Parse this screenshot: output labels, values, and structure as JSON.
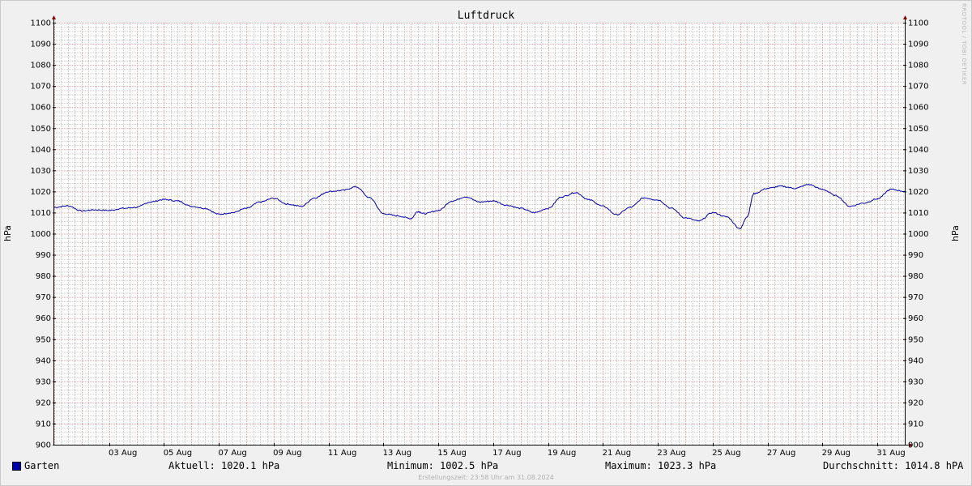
{
  "watermark": "RRDTOOL / TOBI OETIKER",
  "footer": "Erstellungszeit: 23:58 Uhr am 31.08.2024",
  "stats": {
    "series_name": "Garten",
    "aktuell": "Aktuell: 1020.1 hPa",
    "minimum": "Minimum: 1002.5 hPa",
    "maximum": "Maximum: 1023.3 hPa",
    "durchschnitt": "Durchschnitt: 1014.8 hPA"
  },
  "colors": {
    "line": "#0000a8",
    "major_grid": "#e8a0a0",
    "minor_grid": "#c8c8c8",
    "plot_bg": "#ffffff",
    "axis": "#800000"
  },
  "chart_data": {
    "type": "line",
    "title": "Luftdruck",
    "ylabel_left": "hPa",
    "ylabel_right": "hPa",
    "ylim": [
      900,
      1100
    ],
    "xlim": [
      "2024-08-01",
      "2024-09-01"
    ],
    "y_ticks": [
      900,
      910,
      920,
      930,
      940,
      950,
      960,
      970,
      980,
      990,
      1000,
      1010,
      1020,
      1030,
      1040,
      1050,
      1060,
      1070,
      1080,
      1090,
      1100
    ],
    "x_tick_labels": [
      "03 Aug",
      "05 Aug",
      "07 Aug",
      "09 Aug",
      "11 Aug",
      "13 Aug",
      "15 Aug",
      "17 Aug",
      "19 Aug",
      "21 Aug",
      "23 Aug",
      "25 Aug",
      "27 Aug",
      "29 Aug",
      "31 Aug"
    ],
    "grid": true,
    "series": [
      {
        "name": "Garten",
        "points": [
          [
            "2024-08-01",
            1012.5
          ],
          [
            "2024-08-01 12:00",
            1013.2
          ],
          [
            "2024-08-02",
            1010.8
          ],
          [
            "2024-08-02 12:00",
            1011.3
          ],
          [
            "2024-08-03",
            1011.0
          ],
          [
            "2024-08-03 12:00",
            1012.0
          ],
          [
            "2024-08-04",
            1012.5
          ],
          [
            "2024-08-04 12:00",
            1015.0
          ],
          [
            "2024-08-05",
            1016.2
          ],
          [
            "2024-08-05 12:00",
            1015.5
          ],
          [
            "2024-08-06",
            1013.0
          ],
          [
            "2024-08-06 12:00",
            1012.0
          ],
          [
            "2024-08-07",
            1009.2
          ],
          [
            "2024-08-07 12:00",
            1010.0
          ],
          [
            "2024-08-08",
            1012.0
          ],
          [
            "2024-08-08 12:00",
            1015.0
          ],
          [
            "2024-08-09",
            1016.8
          ],
          [
            "2024-08-09 12:00",
            1014.0
          ],
          [
            "2024-08-10",
            1013.0
          ],
          [
            "2024-08-10 12:00",
            1017.0
          ],
          [
            "2024-08-11",
            1020.0
          ],
          [
            "2024-08-11 12:00",
            1020.5
          ],
          [
            "2024-08-12",
            1022.2
          ],
          [
            "2024-08-12 12:00",
            1017.0
          ],
          [
            "2024-08-13",
            1009.5
          ],
          [
            "2024-08-13 12:00",
            1008.5
          ],
          [
            "2024-08-14",
            1007.2
          ],
          [
            "2024-08-14 06:00",
            1010.5
          ],
          [
            "2024-08-14 12:00",
            1009.5
          ],
          [
            "2024-08-15",
            1011.0
          ],
          [
            "2024-08-15 12:00",
            1015.5
          ],
          [
            "2024-08-16",
            1017.5
          ],
          [
            "2024-08-16 12:00",
            1015.0
          ],
          [
            "2024-08-17",
            1015.5
          ],
          [
            "2024-08-17 12:00",
            1013.5
          ],
          [
            "2024-08-18",
            1012.0
          ],
          [
            "2024-08-18 12:00",
            1010.0
          ],
          [
            "2024-08-19",
            1012.0
          ],
          [
            "2024-08-19 12:00",
            1017.5
          ],
          [
            "2024-08-20",
            1019.5
          ],
          [
            "2024-08-20 12:00",
            1016.0
          ],
          [
            "2024-08-21",
            1013.0
          ],
          [
            "2024-08-21 12:00",
            1009.0
          ],
          [
            "2024-08-22",
            1012.5
          ],
          [
            "2024-08-22 12:00",
            1017.0
          ],
          [
            "2024-08-23",
            1016.0
          ],
          [
            "2024-08-23 12:00",
            1012.0
          ],
          [
            "2024-08-24",
            1007.5
          ],
          [
            "2024-08-24 12:00",
            1006.0
          ],
          [
            "2024-08-25",
            1010.0
          ],
          [
            "2024-08-25 12:00",
            1008.0
          ],
          [
            "2024-08-26",
            1002.5
          ],
          [
            "2024-08-26 06:00",
            1008.0
          ],
          [
            "2024-08-26 12:00",
            1019.0
          ],
          [
            "2024-08-27",
            1021.5
          ],
          [
            "2024-08-27 12:00",
            1022.5
          ],
          [
            "2024-08-28",
            1021.5
          ],
          [
            "2024-08-28 12:00",
            1023.3
          ],
          [
            "2024-08-29",
            1021.0
          ],
          [
            "2024-08-29 12:00",
            1018.0
          ],
          [
            "2024-08-30",
            1013.0
          ],
          [
            "2024-08-30 12:00",
            1014.5
          ],
          [
            "2024-08-31",
            1016.5
          ],
          [
            "2024-08-31 12:00",
            1021.0
          ],
          [
            "2024-09-01",
            1020.1
          ]
        ]
      }
    ]
  }
}
